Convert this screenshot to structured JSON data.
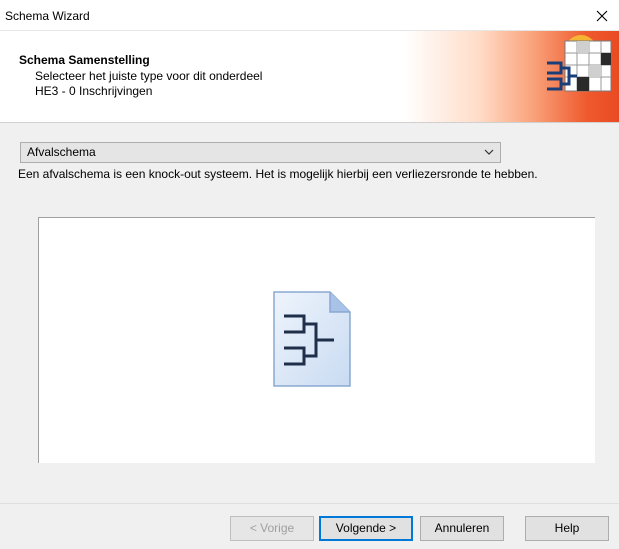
{
  "window": {
    "title": "Schema Wizard"
  },
  "header": {
    "title": "Schema Samenstelling",
    "subtitle": "Selecteer het juiste type voor dit onderdeel",
    "event": "HE3 - 0 Inschrijvingen",
    "accent_color": "#e94a22"
  },
  "schema_type": {
    "selected": "Afvalschema",
    "description": "Een afvalschema is een knock-out systeem. Het is mogelijk hierbij een verliezersronde te hebben."
  },
  "preview": {
    "icon": "bracket-document-icon"
  },
  "buttons": {
    "prev": "< Vorige",
    "next": "Volgende >",
    "cancel": "Annuleren",
    "help": "Help"
  },
  "colors": {
    "focus": "#0078d7",
    "bracket_icon_fill": "#d8e6f7",
    "bracket_icon_stroke": "#3a6aa8"
  }
}
